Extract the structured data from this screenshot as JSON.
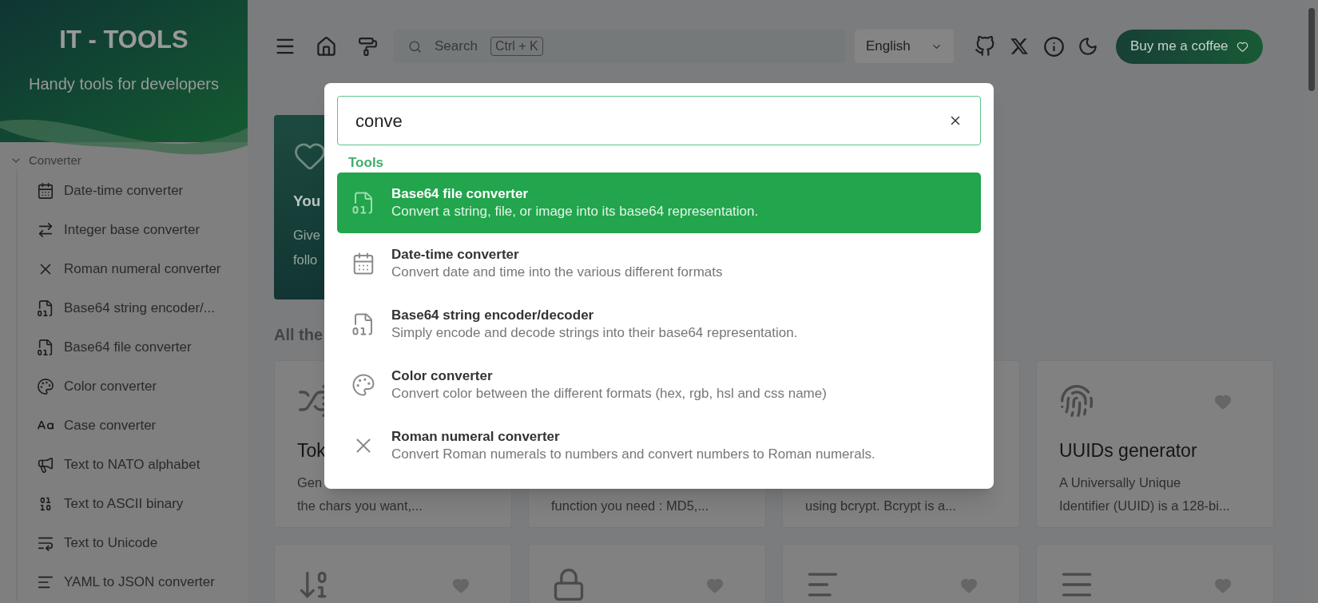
{
  "sidebar": {
    "title": "IT - TOOLS",
    "subtitle": "Handy tools for developers",
    "section": {
      "label": "Converter",
      "expanded": true,
      "items": [
        {
          "label": "Date-time converter"
        },
        {
          "label": "Integer base converter"
        },
        {
          "label": "Roman numeral converter"
        },
        {
          "label": "Base64 string encoder/..."
        },
        {
          "label": "Base64 file converter"
        },
        {
          "label": "Color converter"
        },
        {
          "label": "Case converter"
        },
        {
          "label": "Text to NATO alphabet"
        },
        {
          "label": "Text to ASCII binary"
        },
        {
          "label": "Text to Unicode"
        },
        {
          "label": "YAML to JSON converter"
        }
      ]
    }
  },
  "topbar": {
    "search_placeholder": "Search",
    "shortcut": "Ctrl + K",
    "language": "English",
    "donate_button": "Buy me a coffee"
  },
  "hero_card": {
    "title": "You",
    "text_lines": [
      "Give",
      "follo"
    ]
  },
  "section_heading": "All the",
  "tool_cards": [
    {
      "title": "Tok",
      "description_lines": [
        "Gen",
        "the chars you want,..."
      ]
    },
    {
      "description_lines": [
        "function you need : MD5,..."
      ]
    },
    {
      "description_lines": [
        "using bcrypt. Bcrypt is a..."
      ]
    },
    {
      "title": "UUIDs generator",
      "description_lines": [
        "A Universally Unique",
        "Identifier (UUID) is a 128-bi..."
      ]
    }
  ],
  "search_dialog": {
    "query": "conve",
    "group_label": "Tools",
    "results": [
      {
        "title": "Base64 file converter",
        "description": "Convert a string, file, or image into its base64 representation.",
        "selected": true
      },
      {
        "title": "Date-time converter",
        "description": "Convert date and time into the various different formats",
        "selected": false
      },
      {
        "title": "Base64 string encoder/decoder",
        "description": "Simply encode and decode strings into their base64 representation.",
        "selected": false
      },
      {
        "title": "Color converter",
        "description": "Convert color between the different formats (hex, rgb, hsl and css name)",
        "selected": false
      },
      {
        "title": "Roman numeral converter",
        "description": "Convert Roman numerals to numbers and convert numbers to Roman numerals.",
        "selected": false
      }
    ]
  }
}
